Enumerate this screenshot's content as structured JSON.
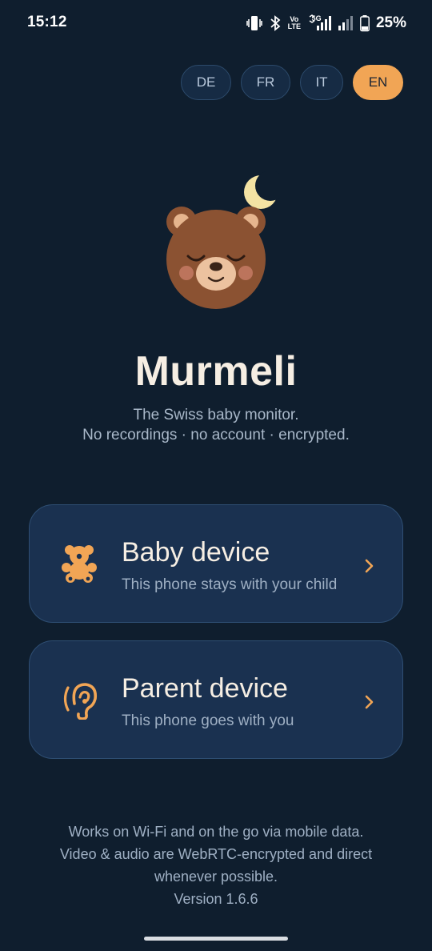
{
  "status_bar": {
    "time": "15:12",
    "volte_top": "Vo",
    "volte_bottom": "LTE",
    "network": "5G",
    "battery_percent": "25%",
    "icons": [
      "vibrate-icon",
      "bluetooth-icon",
      "volte-icon",
      "signal-5g-icon",
      "signal-icon",
      "battery-icon"
    ]
  },
  "languages": [
    {
      "code": "DE",
      "active": false
    },
    {
      "code": "FR",
      "active": false
    },
    {
      "code": "IT",
      "active": false
    },
    {
      "code": "EN",
      "active": true
    }
  ],
  "hero": {
    "title": "Murmeli",
    "tagline_line1": "The Swiss baby monitor.",
    "tagline_line2": "No recordings · no account · encrypted."
  },
  "modes": {
    "baby": {
      "title": "Baby device",
      "subtitle": "This phone stays with your child",
      "icon": "teddy-bear-icon"
    },
    "parent": {
      "title": "Parent device",
      "subtitle": "This phone goes with you",
      "icon": "ear-icon"
    }
  },
  "footer": {
    "line1": "Works on Wi-Fi and on the go via mobile data.",
    "line2": "Video & audio are WebRTC-encrypted and direct",
    "line3": "whenever possible.",
    "version": "Version 1.6.6"
  },
  "colors": {
    "background": "#0f1e2e",
    "accent": "#f1a555",
    "card": "#1a3150",
    "text_primary": "#f6eee3",
    "text_secondary": "#9fb0c4"
  }
}
